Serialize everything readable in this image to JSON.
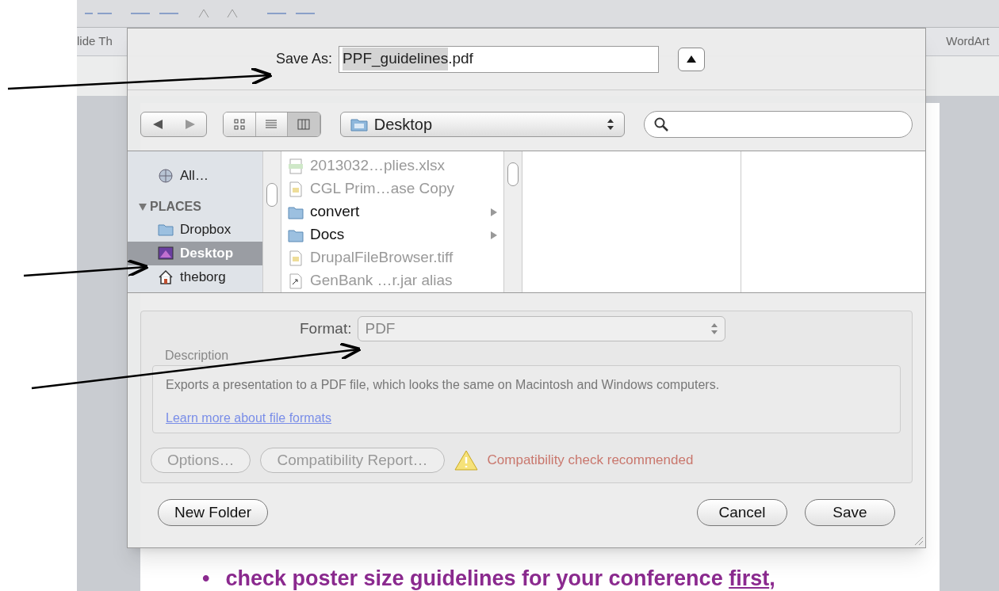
{
  "ribbon_tabs": [
    {
      "label": "lide Th"
    },
    {
      "label": "WordArt"
    }
  ],
  "dialog": {
    "save_as": {
      "label": "Save As:",
      "filename_selected": "PPF_guidelines",
      "filename_rest": ".pdf",
      "expanded": true
    },
    "location": "Desktop",
    "view_modes": [
      {
        "kind": "icons",
        "selected": false
      },
      {
        "kind": "list",
        "selected": false
      },
      {
        "kind": "columns",
        "selected": true
      }
    ],
    "sidebar": [
      {
        "kind": "network",
        "label": "All…",
        "selected": false
      },
      {
        "kind": "header",
        "label": "PLACES"
      },
      {
        "kind": "folder",
        "label": "Dropbox",
        "selected": false
      },
      {
        "kind": "desktop",
        "label": "Desktop",
        "selected": true
      },
      {
        "kind": "home",
        "label": "theborg",
        "selected": false
      }
    ],
    "files": [
      {
        "kind": "xlsx",
        "name": "2013032…plies.xlsx",
        "disabled": true
      },
      {
        "kind": "document",
        "name": "CGL Prim…ase Copy",
        "disabled": true
      },
      {
        "kind": "folder",
        "name": "convert",
        "disabled": false
      },
      {
        "kind": "folder",
        "name": "Docs",
        "disabled": false
      },
      {
        "kind": "document",
        "name": "DrupalFileBrowser.tiff",
        "disabled": true
      },
      {
        "kind": "alias",
        "name": "GenBank …r.jar alias",
        "disabled": true
      }
    ],
    "format": {
      "label": "Format:",
      "value": "PDF"
    },
    "description": {
      "label": "Description",
      "text": "Exports a presentation to a PDF file, which looks the same on Macintosh and Windows computers.",
      "link": "Learn more about file formats"
    },
    "option_buttons": [
      {
        "label": "Options…",
        "disabled": true
      },
      {
        "label": "Compatibility Report…",
        "disabled": true
      }
    ],
    "warning": "Compatibility check recommended",
    "new_folder": "New Folder",
    "buttons": [
      {
        "label": "Cancel",
        "default": false
      },
      {
        "label": "Save",
        "default": false
      }
    ]
  },
  "slide": {
    "bullet": "•",
    "text": "check poster size guidelines for your conference",
    "underlined": "first",
    "after": ","
  }
}
